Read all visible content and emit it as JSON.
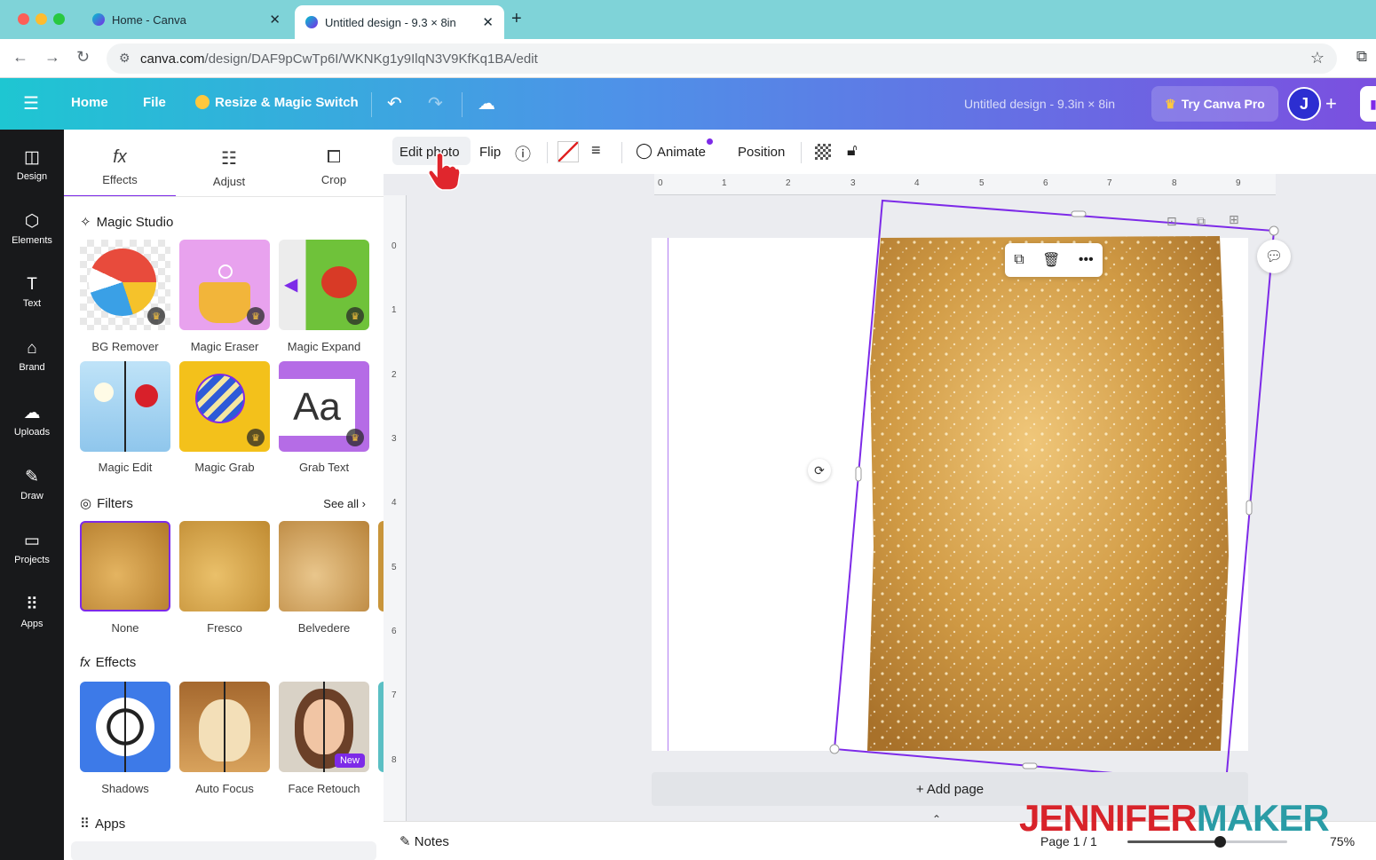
{
  "browser": {
    "tabs": [
      {
        "title": "Home - Canva",
        "active": false
      },
      {
        "title": "Untitled design - 9.3 × 8in",
        "active": true
      }
    ],
    "url_host": "canva.com",
    "url_path": "/design/DAF9pCwTp6I/WKNKg1y9IlqN3V9KfKq1BA/edit"
  },
  "header": {
    "home": "Home",
    "file": "File",
    "resize": "Resize & Magic Switch",
    "doc_title": "Untitled design - 9.3in × 8in",
    "try_pro": "Try Canva Pro",
    "avatar_initial": "J"
  },
  "rail": {
    "items": [
      {
        "label": "Design",
        "icon": "layout-icon"
      },
      {
        "label": "Elements",
        "icon": "shapes-icon"
      },
      {
        "label": "Text",
        "icon": "text-icon"
      },
      {
        "label": "Brand",
        "icon": "brand-icon"
      },
      {
        "label": "Uploads",
        "icon": "cloud-upload-icon"
      },
      {
        "label": "Draw",
        "icon": "pen-icon"
      },
      {
        "label": "Projects",
        "icon": "folder-icon"
      },
      {
        "label": "Apps",
        "icon": "grid-icon"
      }
    ]
  },
  "panel": {
    "tabs": [
      {
        "label": "Effects",
        "active": true
      },
      {
        "label": "Adjust",
        "active": false
      },
      {
        "label": "Crop",
        "active": false
      }
    ],
    "magic_studio_title": "Magic Studio",
    "magic_items": [
      "BG Remover",
      "Magic Eraser",
      "Magic Expand",
      "Magic Edit",
      "Magic Grab",
      "Grab Text"
    ],
    "filters_title": "Filters",
    "see_all": "See all",
    "filters": [
      "None",
      "Fresco",
      "Belvedere"
    ],
    "effects_title": "Effects",
    "effects": [
      "Shadows",
      "Auto Focus",
      "Face Retouch"
    ],
    "new_badge": "New",
    "apps_title": "Apps"
  },
  "toolbar": {
    "edit_photo": "Edit photo",
    "flip": "Flip",
    "animate": "Animate",
    "position": "Position"
  },
  "canvas": {
    "ruler_top": [
      "0",
      "1",
      "2",
      "3",
      "4",
      "5",
      "6",
      "7",
      "8",
      "9"
    ],
    "ruler_left": [
      "0",
      "1",
      "2",
      "3",
      "4",
      "5",
      "6",
      "7",
      "8"
    ],
    "add_page": "+ Add page"
  },
  "bottom": {
    "notes": "Notes",
    "page": "Page 1 / 1",
    "zoom_label": "75%",
    "zoom_fraction": 0.58
  },
  "watermark": {
    "part1": "JENNIFER",
    "part2": "MAKER"
  },
  "colors": {
    "accent": "#7d2ae8",
    "teal": "#00c4cc",
    "glitter": "#c9953a"
  }
}
